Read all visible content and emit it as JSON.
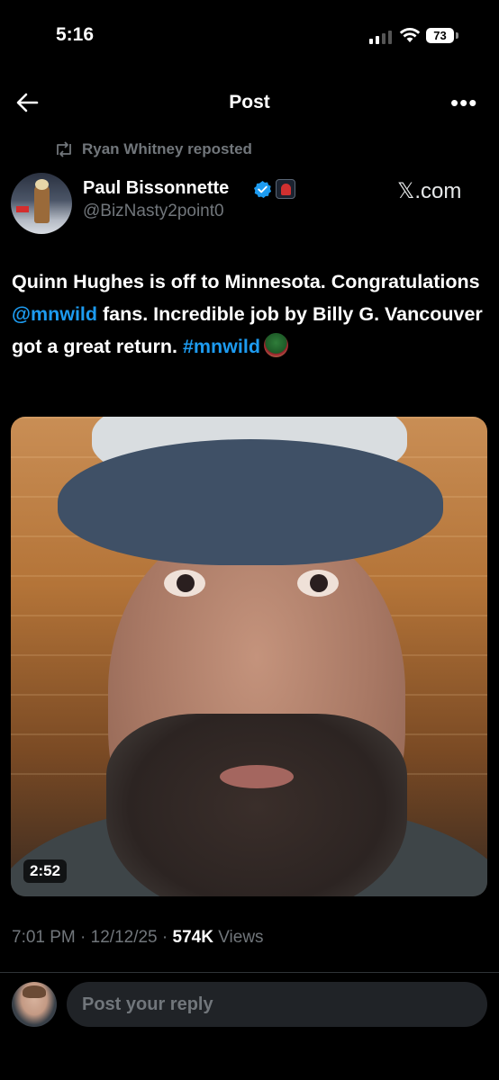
{
  "status_bar": {
    "time": "5:16",
    "battery": "73",
    "icons": [
      "signal-icon",
      "wifi-icon",
      "battery-icon"
    ]
  },
  "header": {
    "title": "Post",
    "icons": [
      "back-arrow-icon",
      "more-icon"
    ]
  },
  "repost": {
    "text": "Ryan Whitney reposted",
    "icon": "repost-icon"
  },
  "author": {
    "name": "Paul Bissonnette",
    "handle": "@BizNasty2point0",
    "source": "𝕏.com",
    "verified_icon": "verified-icon",
    "verified_color": "#1d9bf0"
  },
  "post": {
    "text_part1": "Quinn Hughes is off to Minnesota. Congratulations ",
    "mention": "@mnwild",
    "text_part2": " fans. Incredible job by Billy G. Vancouver got a great return. ",
    "hashtag": "#mnwild",
    "link_color": "#1d9bf0"
  },
  "media": {
    "duration": "2:52"
  },
  "meta": {
    "time": "7:01 PM",
    "date": "12/12/25",
    "views_count": "574K",
    "views_label": "Views"
  },
  "reply": {
    "placeholder": "Post your reply"
  }
}
